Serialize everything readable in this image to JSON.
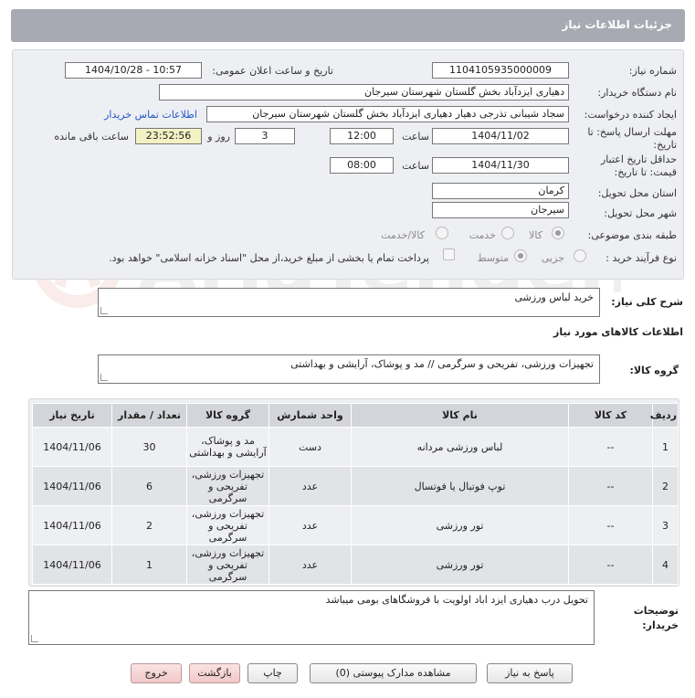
{
  "header": {
    "title": "جزئیات اطلاعات نیاز"
  },
  "form": {
    "need_number_label": "شماره نیاز:",
    "need_number": "1104105935000009",
    "announce_label": "تاریخ و ساعت اعلان عمومی:",
    "announce_value": "1404/10/28 - 10:57",
    "buyer_org_label": "نام دستگاه خریدار:",
    "buyer_org": "دهیاری ایزدآباد بخش گلستان شهرستان سیرجان",
    "creator_label": "ایجاد کننده درخواست:",
    "creator": "سجاد شیبانی تذرجی دهیار دهیاری ایزدآباد بخش گلستان شهرستان سیرجان",
    "contact_link": "اطلاعات تماس خریدار",
    "deadline_label_1": "مهلت ارسال پاسخ: تا",
    "deadline_label_2": "تاریخ:",
    "deadline_date": "1404/11/02",
    "time_label": "ساعت",
    "deadline_time": "12:00",
    "days_value": "3",
    "days_label": "روز و",
    "remaining_time": "23:52:56",
    "remaining_label": "ساعت باقی مانده",
    "validity_label_1": "حداقل تاریخ اعتبار",
    "validity_label_2": "قیمت: تا تاریخ:",
    "validity_date": "1404/11/30",
    "validity_time": "08:00",
    "province_label": "استان محل تحویل:",
    "province": "کرمان",
    "city_label": "شهر محل تحویل:",
    "city": "سیرجان",
    "category_label": "طبقه بندی موضوعی:",
    "category_options": [
      "کالا",
      "خدمت",
      "کالا/خدمت"
    ],
    "process_label": "نوع فرآیند خرید :",
    "process_options": [
      "جزیی",
      "متوسط"
    ],
    "treasury_note": "پرداخت تمام یا بخشی از مبلغ خرید،از محل \"اسناد خزانه اسلامی\" خواهد بود."
  },
  "summary": {
    "label": "شرح کلی نیاز:",
    "value": "خرید لباس ورزشی"
  },
  "goods_section_title": "اطلاعات کالاهای مورد نیاز",
  "goods_group": {
    "label": "گروه کالا:",
    "value": "تجهیزات ورزشی، تفریحی و سرگرمی // مد و پوشاک، آرایشی و بهداشتی"
  },
  "table": {
    "headers": [
      "ردیف",
      "کد کالا",
      "نام کالا",
      "واحد شمارش",
      "گروه کالا",
      "تعداد / مقدار",
      "تاریخ نیاز"
    ],
    "rows": [
      [
        "1",
        "--",
        "لباس ورزشی مردانه",
        "دست",
        "مد و پوشاک، آرایشی و بهداشتی",
        "30",
        "1404/11/06"
      ],
      [
        "2",
        "--",
        "توپ فوتبال یا فوتسال",
        "عدد",
        "تجهیزات ورزشی، تفریحی و سرگرمی",
        "6",
        "1404/11/06"
      ],
      [
        "3",
        "--",
        "تور ورزشی",
        "عدد",
        "تجهیزات ورزشی، تفریحی و سرگرمی",
        "2",
        "1404/11/06"
      ],
      [
        "4",
        "--",
        "تور ورزشی",
        "عدد",
        "تجهیزات ورزشی، تفریحی و سرگرمی",
        "1",
        "1404/11/06"
      ]
    ]
  },
  "buyer_notes": {
    "label_1": "توضیحات",
    "label_2": "خریدار:",
    "value": "تحویل درب دهیاری ایزد اباد اولویت با فروشگاهای بومی میباشد"
  },
  "buttons": {
    "reply": "پاسخ به نیاز",
    "docs": "مشاهده مدارک پیوستی (0)",
    "print": "چاپ",
    "back": "بازگشت",
    "exit": "خروج"
  },
  "watermark_text": "AriaTender.neT",
  "colors": {
    "header": "#a8aab3",
    "panel": "#eeeff2",
    "remaining": "#f4f1c4",
    "link": "#2255cc"
  }
}
